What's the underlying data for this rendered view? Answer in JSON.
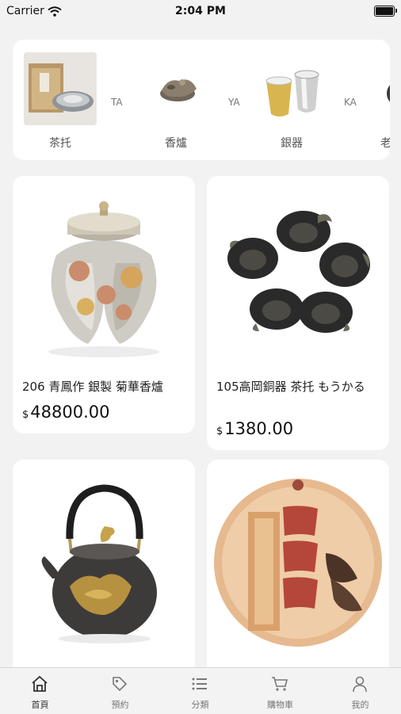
{
  "status_bar": {
    "carrier": "Carrier",
    "time": "2:04 PM"
  },
  "categories": [
    {
      "label": "茶托",
      "code": "TA"
    },
    {
      "label": "香爐",
      "code": "YA"
    },
    {
      "label": "銀器",
      "code": "KA"
    },
    {
      "label": "老"
    }
  ],
  "products": [
    {
      "name": "206 青鳳作 銀製 菊華香爐",
      "currency": "$",
      "price": "48800.00"
    },
    {
      "name": "105高岡銅器 茶托 もうかる",
      "currency": "$",
      "price": "1380.00"
    },
    {
      "name": "",
      "currency": "$",
      "price": ""
    },
    {
      "name": "",
      "currency": "$",
      "price": ""
    }
  ],
  "tabs": [
    {
      "label": "首頁",
      "icon": "home-icon",
      "active": true
    },
    {
      "label": "預約",
      "icon": "tag-icon",
      "active": false
    },
    {
      "label": "分類",
      "icon": "list-icon",
      "active": false
    },
    {
      "label": "購物車",
      "icon": "cart-icon",
      "active": false
    },
    {
      "label": "我的",
      "icon": "person-icon",
      "active": false
    }
  ],
  "colors": {
    "background": "#f2f2f2",
    "card": "#ffffff",
    "text": "#222222"
  }
}
